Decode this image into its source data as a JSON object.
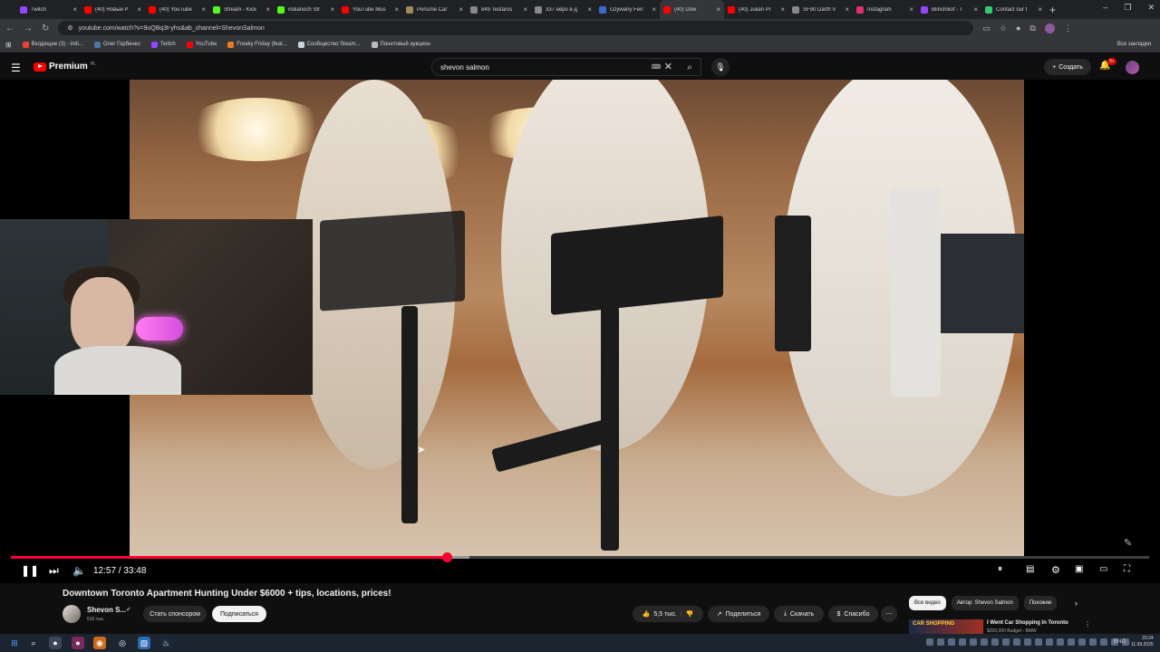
{
  "browser": {
    "tabs": [
      {
        "label": "Twitch",
        "color": "#9146ff",
        "active": false
      },
      {
        "label": "(40) Новый Р",
        "color": "#ff0000",
        "active": false
      },
      {
        "label": "(40) YouTube",
        "color": "#ff0000",
        "active": false
      },
      {
        "label": "Stream - Kick",
        "color": "#53fc18",
        "active": false
      },
      {
        "label": "indianoch Str",
        "color": "#53fc18",
        "active": false
      },
      {
        "label": "YouTube Mus",
        "color": "#ff0000",
        "active": false
      },
      {
        "label": "Porsche Car",
        "color": "#a08a5a",
        "active": false
      },
      {
        "label": "849 Testaros",
        "color": "#888888",
        "active": false
      },
      {
        "label": "337 евро в д",
        "color": "#888888",
        "active": false
      },
      {
        "label": "Używany Ferr",
        "color": "#3a6ad0",
        "active": false
      },
      {
        "label": "(40) Dow",
        "color": "#ff0000",
        "active": true
      },
      {
        "label": "(40) Julian Pr",
        "color": "#ff0000",
        "active": false
      },
      {
        "label": "SF90 Darth V",
        "color": "#888888",
        "active": false
      },
      {
        "label": "Instagram",
        "color": "#e1306c",
        "active": false
      },
      {
        "label": "Blinchikof - T",
        "color": "#9146ff",
        "active": false
      },
      {
        "label": "Contact our t",
        "color": "#2ecc71",
        "active": false
      }
    ],
    "new_tab": "+",
    "window_controls": {
      "minimize": "–",
      "restore": "❐",
      "close": "✕"
    },
    "url": "youtube.com/watch?v=9oQBq3t-yhs&ab_channel=ShevonSalmon",
    "bookmarks": [
      {
        "label": "Входящие (3) - indi...",
        "color": "#ea4335"
      },
      {
        "label": "Олег Горбенко",
        "color": "#4a76a8"
      },
      {
        "label": "Twitch",
        "color": "#9146ff"
      },
      {
        "label": "YouTube",
        "color": "#ff0000"
      },
      {
        "label": "Freaky Friday (feat...",
        "color": "#e67e22"
      },
      {
        "label": "Сообщество Steam...",
        "color": "#c7d5e0"
      },
      {
        "label": "Понитовый аукцион",
        "color": "#bbbbbb"
      }
    ],
    "bookmarks_all": "Все закладки"
  },
  "youtube": {
    "logo_text": "Premium",
    "logo_region": "PL",
    "search_value": "shevon salmon",
    "create_label": "Создать",
    "notifications_badge": "9+",
    "video": {
      "current_time": "12:57",
      "duration": "33:48",
      "time_display": "12:57 / 33:48",
      "progress_fraction": 0.383,
      "buffer_fraction": 0.403,
      "title": "Downtown Toronto Apartment Hunting Under $6000 + tips, locations, prices!"
    },
    "channel": {
      "name": "Shevon S...",
      "subscribers": "510 тыс.",
      "sponsor_label": "Стать спонсором",
      "subscribe_label": "Подписаться"
    },
    "actions": {
      "likes": "5,5 тыс.",
      "share": "Поделиться",
      "download": "Скачать",
      "thanks": "Спасибо",
      "more": "⋯"
    },
    "chips": [
      "Все видео",
      "Автор: Shevon Salmon",
      "Похожие"
    ],
    "recommendation": {
      "thumb_text": "CAR SHOPPING",
      "title": "I Went Car Shopping In Toronto",
      "subtitle": "$200,000 Budget - BMW"
    }
  },
  "taskbar": {
    "lang": "ENG",
    "time": "23:24",
    "date": "11.09.2025"
  },
  "colors": {
    "accent_red": "#ff0033",
    "yt_bg": "#0f0f0f",
    "chrome_bg": "#202124"
  }
}
